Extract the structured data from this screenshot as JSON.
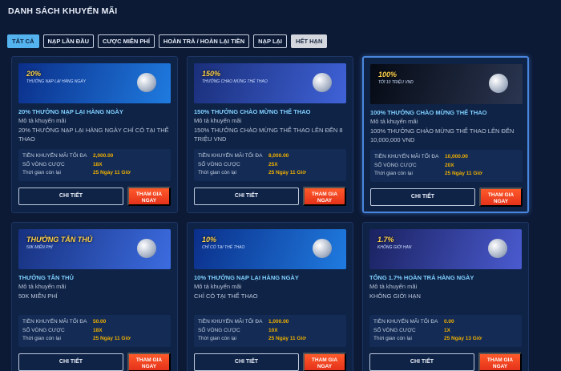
{
  "page_title": "DANH SÁCH KHUYẾN MÃI",
  "tabs": [
    {
      "label": "TẤT CẢ",
      "state": "active"
    },
    {
      "label": "NẠP LẦN ĐẦU",
      "state": "normal"
    },
    {
      "label": "CƯỢC MIỄN PHÍ",
      "state": "normal"
    },
    {
      "label": "HOÀN TRẢ / HOÀN LẠI TIỀN",
      "state": "normal"
    },
    {
      "label": "NẠP LẠI",
      "state": "normal"
    },
    {
      "label": "HẾT HẠN",
      "state": "grey"
    }
  ],
  "labels": {
    "desc_label": "Mô tả khuyến mãi",
    "max_bonus": "TIỀN KHUYẾN MÃI TỐI ĐA",
    "wager_rounds": "SỐ VÒNG CƯỢC",
    "time_left": "Thời gian còn lại",
    "detail_button": "CHI TIẾT",
    "join_button": "THAM GIA NGAY"
  },
  "cards": [
    {
      "title": "20% THƯỞNG NẠP LẠI HÀNG NGÀY",
      "description": "20% THƯỞNG NẠP LẠI HÀNG NGÀY CHỈ CÓ TẠI THỂ THAO",
      "max_bonus": "2,000.00",
      "wager": "18X",
      "time_left": "25 Ngày 11 Giờ",
      "banner_text": "20%",
      "banner_sub": "THƯỞNG NẠP LẠI HÀNG NGÀY",
      "banner_colors": [
        "#0b2f8a",
        "#1f7be0"
      ],
      "highlight": false
    },
    {
      "title": "150% THƯỞNG CHÀO MỪNG THỂ THAO",
      "description": "150% THƯỞNG CHÀO MỪNG THỂ THAO LÊN ĐẾN 8 TRIỆU VND",
      "max_bonus": "8,000.00",
      "wager": "25X",
      "time_left": "25 Ngày 11 Giờ",
      "banner_text": "150%",
      "banner_sub": "THƯỞNG CHÀO MỪNG THỂ THAO",
      "banner_colors": [
        "#1a2f7a",
        "#3f62d8"
      ],
      "highlight": false
    },
    {
      "title": "100% THƯỞNG CHÀO MỪNG THỂ THAO",
      "description": "100% THƯỞNG CHÀO MỪNG THỂ THAO LÊN ĐẾN 10,000,000 VND",
      "max_bonus": "10,000.00",
      "wager": "20X",
      "time_left": "25 Ngày 11 Giờ",
      "banner_text": "100%",
      "banner_sub": "TỚI 10 TRIỆU VND",
      "banner_colors": [
        "#050a14",
        "#2a3550"
      ],
      "highlight": true
    },
    {
      "title": "THƯỞNG TÂN THỦ",
      "description": "50K MIỄN PHÍ",
      "max_bonus": "50.00",
      "wager": "18X",
      "time_left": "25 Ngày 11 Giờ",
      "banner_text": "THƯỞNG TÂN THỦ",
      "banner_sub": "50K MIỄN PHÍ",
      "banner_colors": [
        "#17317f",
        "#3c6ce0"
      ],
      "highlight": false
    },
    {
      "title": "10% THƯỞNG NẠP LẠI HÀNG NGÀY",
      "description": "CHỈ CÓ TẠI THỂ THAO",
      "max_bonus": "1,000.00",
      "wager": "10X",
      "time_left": "25 Ngày 11 Giờ",
      "banner_text": "10%",
      "banner_sub": "CHỈ CÓ TẠI THỂ THAO",
      "banner_colors": [
        "#0b2f8a",
        "#1f7be0"
      ],
      "highlight": false
    },
    {
      "title": "TỔNG 1.7% HOÀN TRẢ HÀNG NGÀY",
      "description": "KHÔNG GIỚI HẠN",
      "max_bonus": "0.00",
      "wager": "1X",
      "time_left": "25 Ngày 13 Giờ",
      "banner_text": "1.7%",
      "banner_sub": "KHÔNG GIỚI HẠN",
      "banner_colors": [
        "#1a2260",
        "#4a5bd0"
      ],
      "highlight": false
    }
  ]
}
